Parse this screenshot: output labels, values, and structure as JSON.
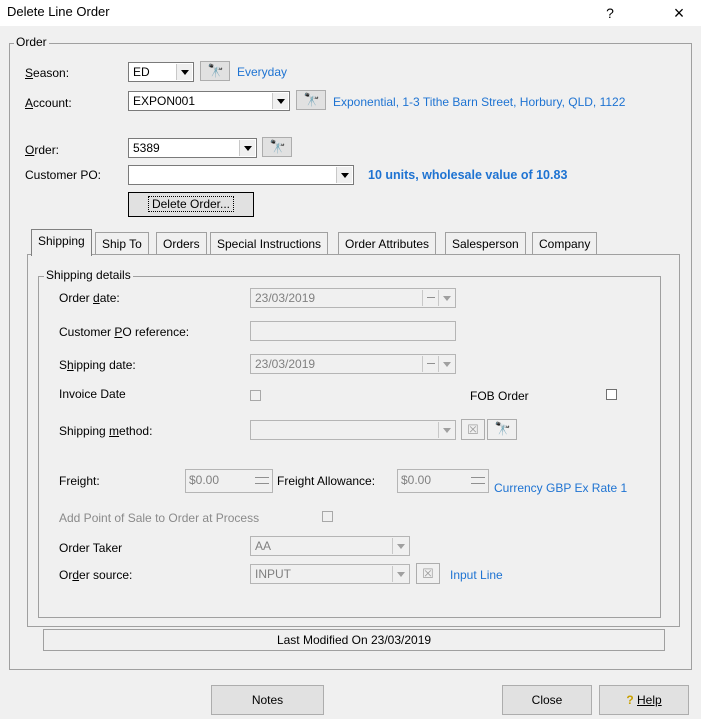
{
  "window": {
    "title": "Delete Line Order",
    "help_glyph": "?",
    "close_glyph": "×"
  },
  "order_group": {
    "legend": "Order",
    "season": {
      "label": "Season:",
      "value": "ED",
      "description": "Everyday"
    },
    "account": {
      "label": "Account:",
      "value": "EXPON001",
      "description": "Exponential, 1-3 Tithe Barn Street, Horbury, QLD, 1122"
    },
    "order": {
      "label": "Order:",
      "value": "5389"
    },
    "customer_po": {
      "label": "Customer PO:",
      "value": "",
      "summary": "10 units, wholesale value of 10.83"
    },
    "delete_button": "Delete Order..."
  },
  "tabs": [
    "Shipping",
    "Ship To",
    "Orders",
    "Special Instructions",
    "Order Attributes",
    "Salesperson",
    "Company"
  ],
  "shipping": {
    "legend": "Shipping details",
    "order_date": {
      "label": "Order date:",
      "value": "23/03/2019"
    },
    "customer_po_reference": {
      "label": "Customer PO reference:",
      "value": ""
    },
    "shipping_date": {
      "label": "Shipping date:",
      "value": "23/03/2019"
    },
    "invoice_date": {
      "label": "Invoice Date",
      "checked": false
    },
    "fob_order": {
      "label": "FOB Order",
      "checked": false
    },
    "shipping_method": {
      "label": "Shipping method:",
      "value": ""
    },
    "freight": {
      "label": "Freight:",
      "value": "$0.00"
    },
    "freight_allowance": {
      "label": "Freight Allowance:",
      "value": "$0.00"
    },
    "currency_text": "Currency GBP Ex Rate 1",
    "add_pos": {
      "label": "Add Point of Sale to Order at Process",
      "checked": false
    },
    "order_taker": {
      "label": "Order Taker",
      "value": "AA"
    },
    "order_source": {
      "label": "Order source:",
      "value": "INPUT",
      "link": "Input Line"
    }
  },
  "status_bar": "Last Modified On 23/03/2019",
  "buttons": {
    "notes": "Notes",
    "close": "Close",
    "help": "Help",
    "help_icon": "?"
  },
  "icons": {
    "binoculars": "binoculars-icon",
    "clear": "clear-icon",
    "help_key": "help-key-icon"
  },
  "colors": {
    "link": "#1e73d2",
    "window_bg": "#f0f0f0"
  }
}
